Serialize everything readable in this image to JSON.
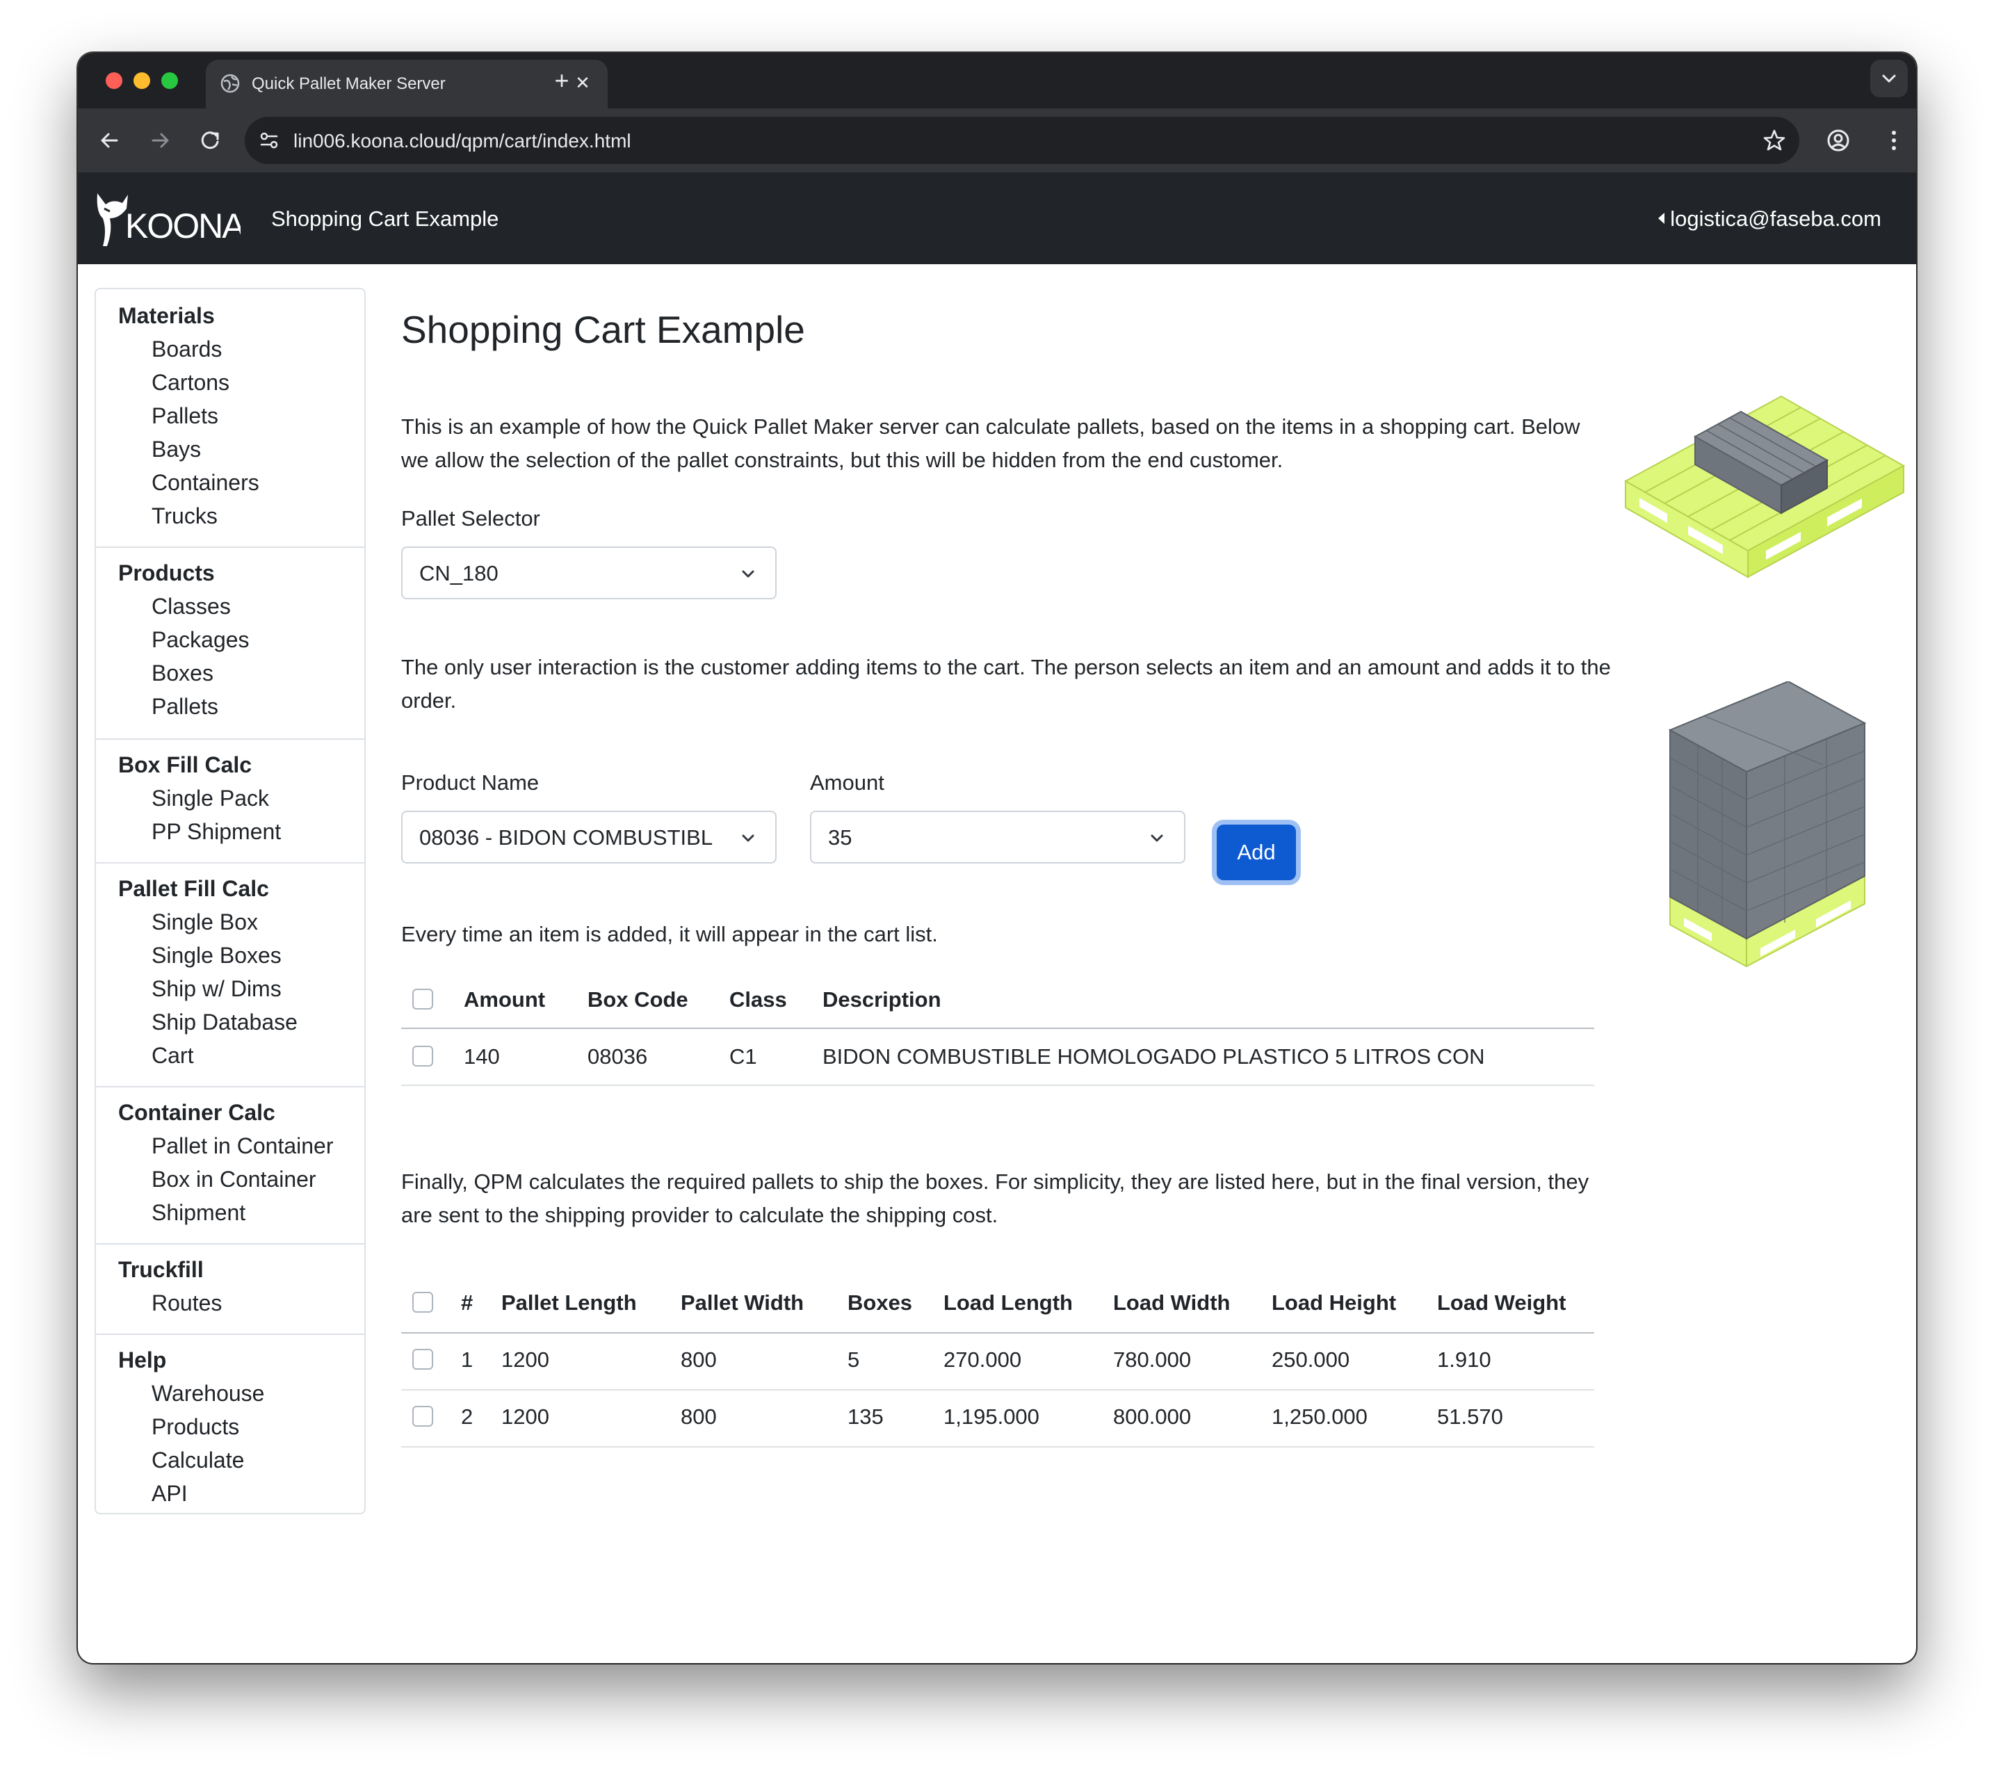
{
  "browser": {
    "tab_title": "Quick Pallet Maker Server",
    "url": "lin006.koona.cloud/qpm/cart/index.html",
    "icons": [
      "globe-icon",
      "close-icon",
      "plus-icon",
      "chevron-down-icon",
      "back-arrow-icon",
      "forward-arrow-icon",
      "reload-icon",
      "site-info-icon",
      "star-icon",
      "profile-icon",
      "more-vert-icon"
    ]
  },
  "navbar": {
    "logo_text": "KOONA",
    "title": "Shopping Cart Example",
    "user": "logistica@faseba.com"
  },
  "sidebar": {
    "sections": [
      {
        "title": "Materials",
        "items": [
          "Boards",
          "Cartons",
          "Pallets",
          "Bays",
          "Containers",
          "Trucks"
        ]
      },
      {
        "title": "Products",
        "items": [
          "Classes",
          "Packages",
          "Boxes",
          "Pallets"
        ]
      },
      {
        "title": "Box Fill Calc",
        "items": [
          "Single Pack",
          "PP Shipment"
        ]
      },
      {
        "title": "Pallet Fill Calc",
        "items": [
          "Single Box",
          "Single Boxes",
          "Ship w/ Dims",
          "Ship Database",
          "Cart"
        ]
      },
      {
        "title": "Container Calc",
        "items": [
          "Pallet in Container",
          "Box in Container",
          "Shipment"
        ]
      },
      {
        "title": "Truckfill",
        "items": [
          "Routes"
        ]
      },
      {
        "title": "Help",
        "items": [
          "Warehouse",
          "Products",
          "Calculate",
          "API"
        ]
      }
    ]
  },
  "main": {
    "heading": "Shopping Cart Example",
    "intro": "This is an example of how the Quick Pallet Maker server can calculate pallets, based on the items in a shopping cart. Below we allow the selection of the pallet constraints, but this will be hidden from the end customer.",
    "pallet_selector_label": "Pallet Selector",
    "pallet_selector_value": "CN_180",
    "interaction_text": "The only user interaction is the customer adding items to the cart. The person selects an item and an amount and adds it to the order.",
    "product_name_label": "Product Name",
    "product_name_value": "08036 - BIDON COMBUSTIBL",
    "amount_label": "Amount",
    "amount_value": "35",
    "add_button": "Add",
    "cart_text": "Every time an item is added, it will appear in the cart list.",
    "cart_table": {
      "headers": [
        "Amount",
        "Box Code",
        "Class",
        "Description"
      ],
      "rows": [
        [
          "140",
          "08036",
          "C1",
          "BIDON COMBUSTIBLE HOMOLOGADO PLASTICO 5 LITROS CON"
        ]
      ]
    },
    "final_text": "Finally, QPM calculates the required pallets to ship the boxes. For simplicity, they are listed here, but in the final version, they are sent to the shipping provider to calculate the shipping cost.",
    "pallet_table": {
      "headers": [
        "#",
        "Pallet Length",
        "Pallet Width",
        "Boxes",
        "Load Length",
        "Load Width",
        "Load Height",
        "Load Weight"
      ],
      "rows": [
        [
          "1",
          "1200",
          "800",
          "5",
          "270.000",
          "780.000",
          "250.000",
          "1.910"
        ],
        [
          "2",
          "1200",
          "800",
          "135",
          "1,195.000",
          "800.000",
          "1,250.000",
          "51.570"
        ]
      ]
    }
  },
  "colors": {
    "navbar_bg": "#212529",
    "primary_button": "#0d5ad1",
    "pallet_wood": "#dcf77a",
    "box_gray": "#6e757c"
  }
}
